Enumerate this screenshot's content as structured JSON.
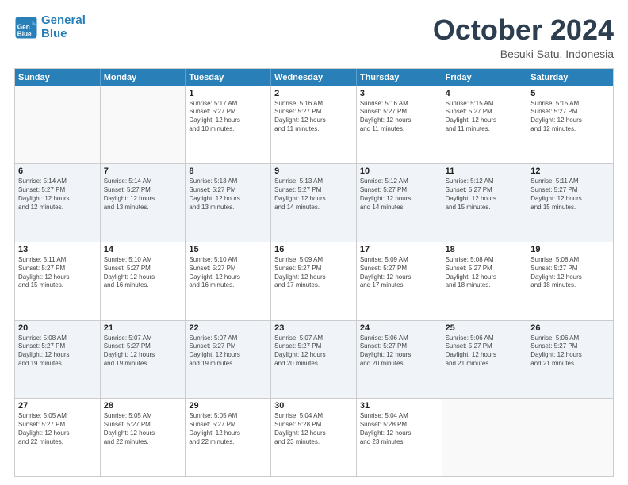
{
  "logo": {
    "line1": "General",
    "line2": "Blue"
  },
  "title": "October 2024",
  "location": "Besuki Satu, Indonesia",
  "weekdays": [
    "Sunday",
    "Monday",
    "Tuesday",
    "Wednesday",
    "Thursday",
    "Friday",
    "Saturday"
  ],
  "rows": [
    [
      {
        "day": "",
        "info": ""
      },
      {
        "day": "",
        "info": ""
      },
      {
        "day": "1",
        "info": "Sunrise: 5:17 AM\nSunset: 5:27 PM\nDaylight: 12 hours\nand 10 minutes."
      },
      {
        "day": "2",
        "info": "Sunrise: 5:16 AM\nSunset: 5:27 PM\nDaylight: 12 hours\nand 11 minutes."
      },
      {
        "day": "3",
        "info": "Sunrise: 5:16 AM\nSunset: 5:27 PM\nDaylight: 12 hours\nand 11 minutes."
      },
      {
        "day": "4",
        "info": "Sunrise: 5:15 AM\nSunset: 5:27 PM\nDaylight: 12 hours\nand 11 minutes."
      },
      {
        "day": "5",
        "info": "Sunrise: 5:15 AM\nSunset: 5:27 PM\nDaylight: 12 hours\nand 12 minutes."
      }
    ],
    [
      {
        "day": "6",
        "info": "Sunrise: 5:14 AM\nSunset: 5:27 PM\nDaylight: 12 hours\nand 12 minutes."
      },
      {
        "day": "7",
        "info": "Sunrise: 5:14 AM\nSunset: 5:27 PM\nDaylight: 12 hours\nand 13 minutes."
      },
      {
        "day": "8",
        "info": "Sunrise: 5:13 AM\nSunset: 5:27 PM\nDaylight: 12 hours\nand 13 minutes."
      },
      {
        "day": "9",
        "info": "Sunrise: 5:13 AM\nSunset: 5:27 PM\nDaylight: 12 hours\nand 14 minutes."
      },
      {
        "day": "10",
        "info": "Sunrise: 5:12 AM\nSunset: 5:27 PM\nDaylight: 12 hours\nand 14 minutes."
      },
      {
        "day": "11",
        "info": "Sunrise: 5:12 AM\nSunset: 5:27 PM\nDaylight: 12 hours\nand 15 minutes."
      },
      {
        "day": "12",
        "info": "Sunrise: 5:11 AM\nSunset: 5:27 PM\nDaylight: 12 hours\nand 15 minutes."
      }
    ],
    [
      {
        "day": "13",
        "info": "Sunrise: 5:11 AM\nSunset: 5:27 PM\nDaylight: 12 hours\nand 15 minutes."
      },
      {
        "day": "14",
        "info": "Sunrise: 5:10 AM\nSunset: 5:27 PM\nDaylight: 12 hours\nand 16 minutes."
      },
      {
        "day": "15",
        "info": "Sunrise: 5:10 AM\nSunset: 5:27 PM\nDaylight: 12 hours\nand 16 minutes."
      },
      {
        "day": "16",
        "info": "Sunrise: 5:09 AM\nSunset: 5:27 PM\nDaylight: 12 hours\nand 17 minutes."
      },
      {
        "day": "17",
        "info": "Sunrise: 5:09 AM\nSunset: 5:27 PM\nDaylight: 12 hours\nand 17 minutes."
      },
      {
        "day": "18",
        "info": "Sunrise: 5:08 AM\nSunset: 5:27 PM\nDaylight: 12 hours\nand 18 minutes."
      },
      {
        "day": "19",
        "info": "Sunrise: 5:08 AM\nSunset: 5:27 PM\nDaylight: 12 hours\nand 18 minutes."
      }
    ],
    [
      {
        "day": "20",
        "info": "Sunrise: 5:08 AM\nSunset: 5:27 PM\nDaylight: 12 hours\nand 19 minutes."
      },
      {
        "day": "21",
        "info": "Sunrise: 5:07 AM\nSunset: 5:27 PM\nDaylight: 12 hours\nand 19 minutes."
      },
      {
        "day": "22",
        "info": "Sunrise: 5:07 AM\nSunset: 5:27 PM\nDaylight: 12 hours\nand 19 minutes."
      },
      {
        "day": "23",
        "info": "Sunrise: 5:07 AM\nSunset: 5:27 PM\nDaylight: 12 hours\nand 20 minutes."
      },
      {
        "day": "24",
        "info": "Sunrise: 5:06 AM\nSunset: 5:27 PM\nDaylight: 12 hours\nand 20 minutes."
      },
      {
        "day": "25",
        "info": "Sunrise: 5:06 AM\nSunset: 5:27 PM\nDaylight: 12 hours\nand 21 minutes."
      },
      {
        "day": "26",
        "info": "Sunrise: 5:06 AM\nSunset: 5:27 PM\nDaylight: 12 hours\nand 21 minutes."
      }
    ],
    [
      {
        "day": "27",
        "info": "Sunrise: 5:05 AM\nSunset: 5:27 PM\nDaylight: 12 hours\nand 22 minutes."
      },
      {
        "day": "28",
        "info": "Sunrise: 5:05 AM\nSunset: 5:27 PM\nDaylight: 12 hours\nand 22 minutes."
      },
      {
        "day": "29",
        "info": "Sunrise: 5:05 AM\nSunset: 5:27 PM\nDaylight: 12 hours\nand 22 minutes."
      },
      {
        "day": "30",
        "info": "Sunrise: 5:04 AM\nSunset: 5:28 PM\nDaylight: 12 hours\nand 23 minutes."
      },
      {
        "day": "31",
        "info": "Sunrise: 5:04 AM\nSunset: 5:28 PM\nDaylight: 12 hours\nand 23 minutes."
      },
      {
        "day": "",
        "info": ""
      },
      {
        "day": "",
        "info": ""
      }
    ]
  ]
}
